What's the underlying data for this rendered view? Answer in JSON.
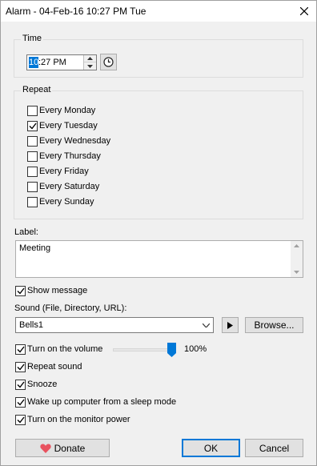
{
  "window": {
    "title": "Alarm - 04-Feb-16 10:27 PM Tue"
  },
  "time_group": {
    "label": "Time",
    "hour_selected": "10",
    "time_rest": ":27 PM"
  },
  "repeat_group": {
    "label": "Repeat",
    "days": [
      {
        "label": "Every Monday",
        "checked": false
      },
      {
        "label": "Every Tuesday",
        "checked": true
      },
      {
        "label": "Every Wednesday",
        "checked": false
      },
      {
        "label": "Every Thursday",
        "checked": false
      },
      {
        "label": "Every Friday",
        "checked": false
      },
      {
        "label": "Every Saturday",
        "checked": false
      },
      {
        "label": "Every Sunday",
        "checked": false
      }
    ]
  },
  "label_field": {
    "caption": "Label:",
    "value": "Meeting"
  },
  "show_message": {
    "label": "Show message",
    "checked": true
  },
  "sound": {
    "caption": "Sound (File, Directory, URL):",
    "value": "Bells1",
    "browse_label": "Browse..."
  },
  "volume": {
    "label": "Turn on the volume",
    "checked": true,
    "percent_text": "100%",
    "level": 1.0
  },
  "options": [
    {
      "label": "Repeat sound",
      "checked": true
    },
    {
      "label": "Snooze",
      "checked": true
    },
    {
      "label": "Wake up computer from a sleep mode",
      "checked": true
    },
    {
      "label": "Turn on the monitor power",
      "checked": true
    }
  ],
  "buttons": {
    "donate": "Donate",
    "ok": "OK",
    "cancel": "Cancel"
  },
  "colors": {
    "accent": "#0078d7",
    "heart": "#e8525f"
  }
}
